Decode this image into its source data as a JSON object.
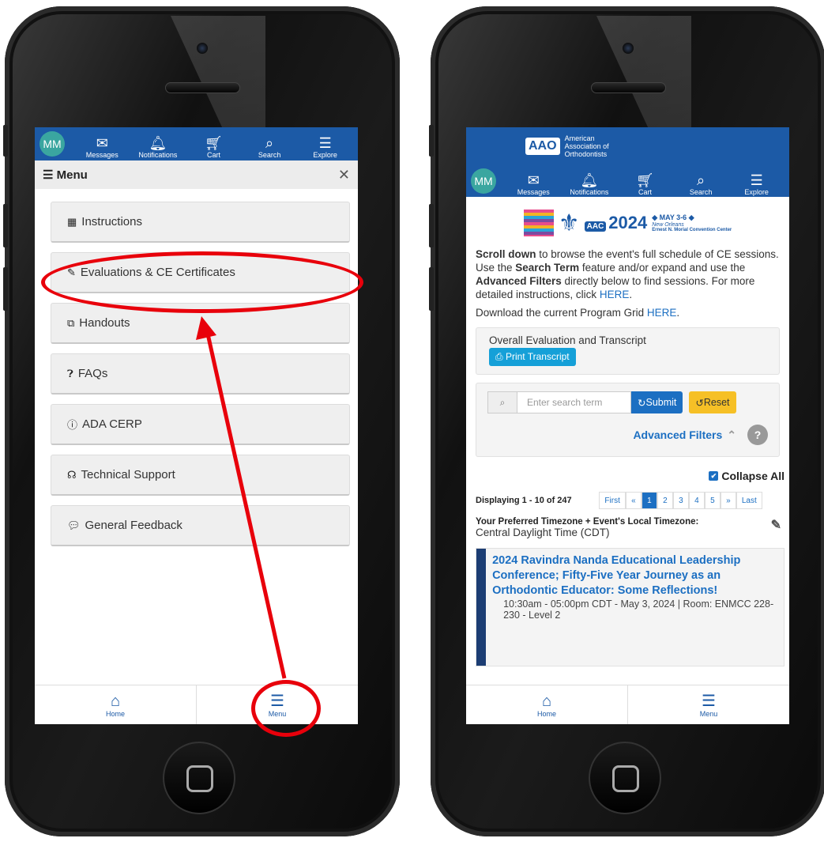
{
  "left": {
    "topbar": {
      "avatar": "MM",
      "items": [
        {
          "label": "Messages",
          "icon": "envelope-icon"
        },
        {
          "label": "Notifications",
          "icon": "bell-icon"
        },
        {
          "label": "Cart",
          "icon": "cart-icon"
        },
        {
          "label": "Search",
          "icon": "search-icon"
        },
        {
          "label": "Explore",
          "icon": "hamburger-icon"
        }
      ]
    },
    "menu_header": {
      "title": "Menu",
      "close": "✕"
    },
    "menu_items": [
      {
        "label": "Instructions",
        "icon": "book-icon"
      },
      {
        "label": "Evaluations & CE Certificates",
        "icon": "edit-icon"
      },
      {
        "label": "Handouts",
        "icon": "copy-icon"
      },
      {
        "label": "FAQs",
        "icon": "question-circle-icon"
      },
      {
        "label": "ADA CERP",
        "icon": "info-circle-icon"
      },
      {
        "label": "Technical Support",
        "icon": "headset-icon"
      },
      {
        "label": "General Feedback",
        "icon": "comment-icon"
      }
    ],
    "bottombar": [
      {
        "label": "Home",
        "icon": "home-icon"
      },
      {
        "label": "Menu",
        "icon": "hamburger-icon"
      }
    ]
  },
  "right": {
    "org": {
      "line1": "American",
      "line2": "Association of",
      "line3": "Orthodontists",
      "logo": "AAO"
    },
    "topbar": {
      "avatar": "MM",
      "items": [
        {
          "label": "Messages"
        },
        {
          "label": "Notifications"
        },
        {
          "label": "Cart"
        },
        {
          "label": "Search"
        },
        {
          "label": "Explore"
        }
      ]
    },
    "banner": {
      "aac": "AAC",
      "year": "2024",
      "dates": "MAY 3-6",
      "city": "New Orleans",
      "venue": "Ernest N. Morial Convention Center"
    },
    "intro": {
      "bold1": "Scroll down",
      "t1": " to browse the event's full schedule of CE sessions. Use the ",
      "bold2": "Search Term",
      "t2": " feature and/or expand and use the ",
      "bold3": "Advanced Filters",
      "t3": " directly below to find sessions. For more detailed instructions, click ",
      "link": "HERE",
      "t4": "."
    },
    "download": {
      "text": "Download the current Program Grid ",
      "link": "HERE",
      "end": "."
    },
    "eval_card": {
      "title": "Overall Evaluation and Transcript",
      "button": "Print Transcript"
    },
    "search": {
      "placeholder": "Enter search term",
      "submit": "Submit",
      "reset": "Reset",
      "advanced": "Advanced Filters",
      "help": "?"
    },
    "collapse_all": "Collapse All",
    "pager": {
      "label": "Displaying 1 - 10 of 247",
      "pages": [
        "First",
        "«",
        "1",
        "2",
        "3",
        "4",
        "5",
        "»",
        "Last"
      ]
    },
    "timezone": {
      "label": "Your Preferred Timezone + Event's Local Timezone:",
      "value": "Central Daylight Time (CDT)"
    },
    "session": {
      "title": "2024 Ravindra Nanda Educational Leadership Conference; Fifty-Five Year Journey as an Orthodontic Educator: Some Reflections!",
      "time": "10:30am - 05:00pm CDT - May 3, 2024 | Room: ENMCC 228-230 - Level 2"
    },
    "bottombar": [
      {
        "label": "Home"
      },
      {
        "label": "Menu"
      }
    ]
  }
}
